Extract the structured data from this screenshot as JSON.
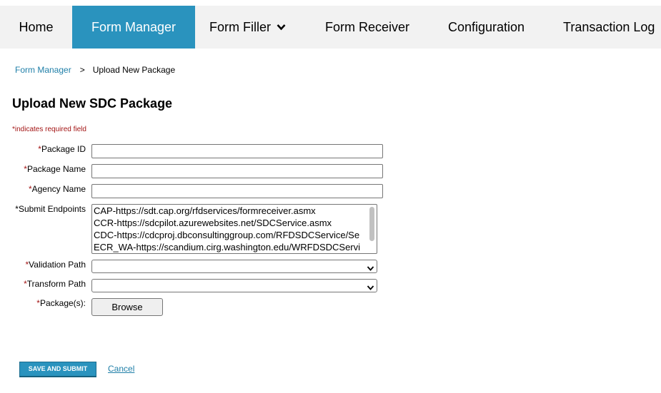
{
  "nav": {
    "items": [
      {
        "label": "Home"
      },
      {
        "label": "Form Manager",
        "active": true
      },
      {
        "label": "Form Filler",
        "icon": "chevron-down-icon"
      },
      {
        "label": "Form Receiver"
      },
      {
        "label": "Configuration"
      },
      {
        "label": "Transaction Log"
      }
    ]
  },
  "breadcrumb": {
    "parent": "Form Manager",
    "separator": ">",
    "current": "Upload New Package"
  },
  "page": {
    "title": "Upload New SDC Package",
    "required_note": "*indicates required field"
  },
  "form": {
    "package_id": {
      "label": "Package ID",
      "value": ""
    },
    "package_name": {
      "label": "Package Name",
      "value": ""
    },
    "agency_name": {
      "label": "Agency Name",
      "value": ""
    },
    "submit_endpoints": {
      "label": "Submit Endpoints",
      "options": [
        "CAP-https://sdt.cap.org/rfdservices/formreceiver.asmx",
        "CCR-https://sdcpilot.azurewebsites.net/SDCService.asmx",
        "CDC-https://cdcproj.dbconsultinggroup.com/RFDSDCService/Se",
        "ECR_WA-https://scandium.cirg.washington.edu/WRFDSDCServi"
      ]
    },
    "validation_path": {
      "label": "Validation Path",
      "value": ""
    },
    "transform_path": {
      "label": "Transform Path",
      "value": ""
    },
    "packages": {
      "label": "Package(s):",
      "button_label": "Browse"
    }
  },
  "actions": {
    "save_label": "SAVE AND SUBMIT",
    "cancel_label": "Cancel"
  },
  "colors": {
    "accent": "#2a93be",
    "required": "#a31515",
    "link": "#1f7fa8",
    "nav_bg": "#f2f2f2"
  }
}
